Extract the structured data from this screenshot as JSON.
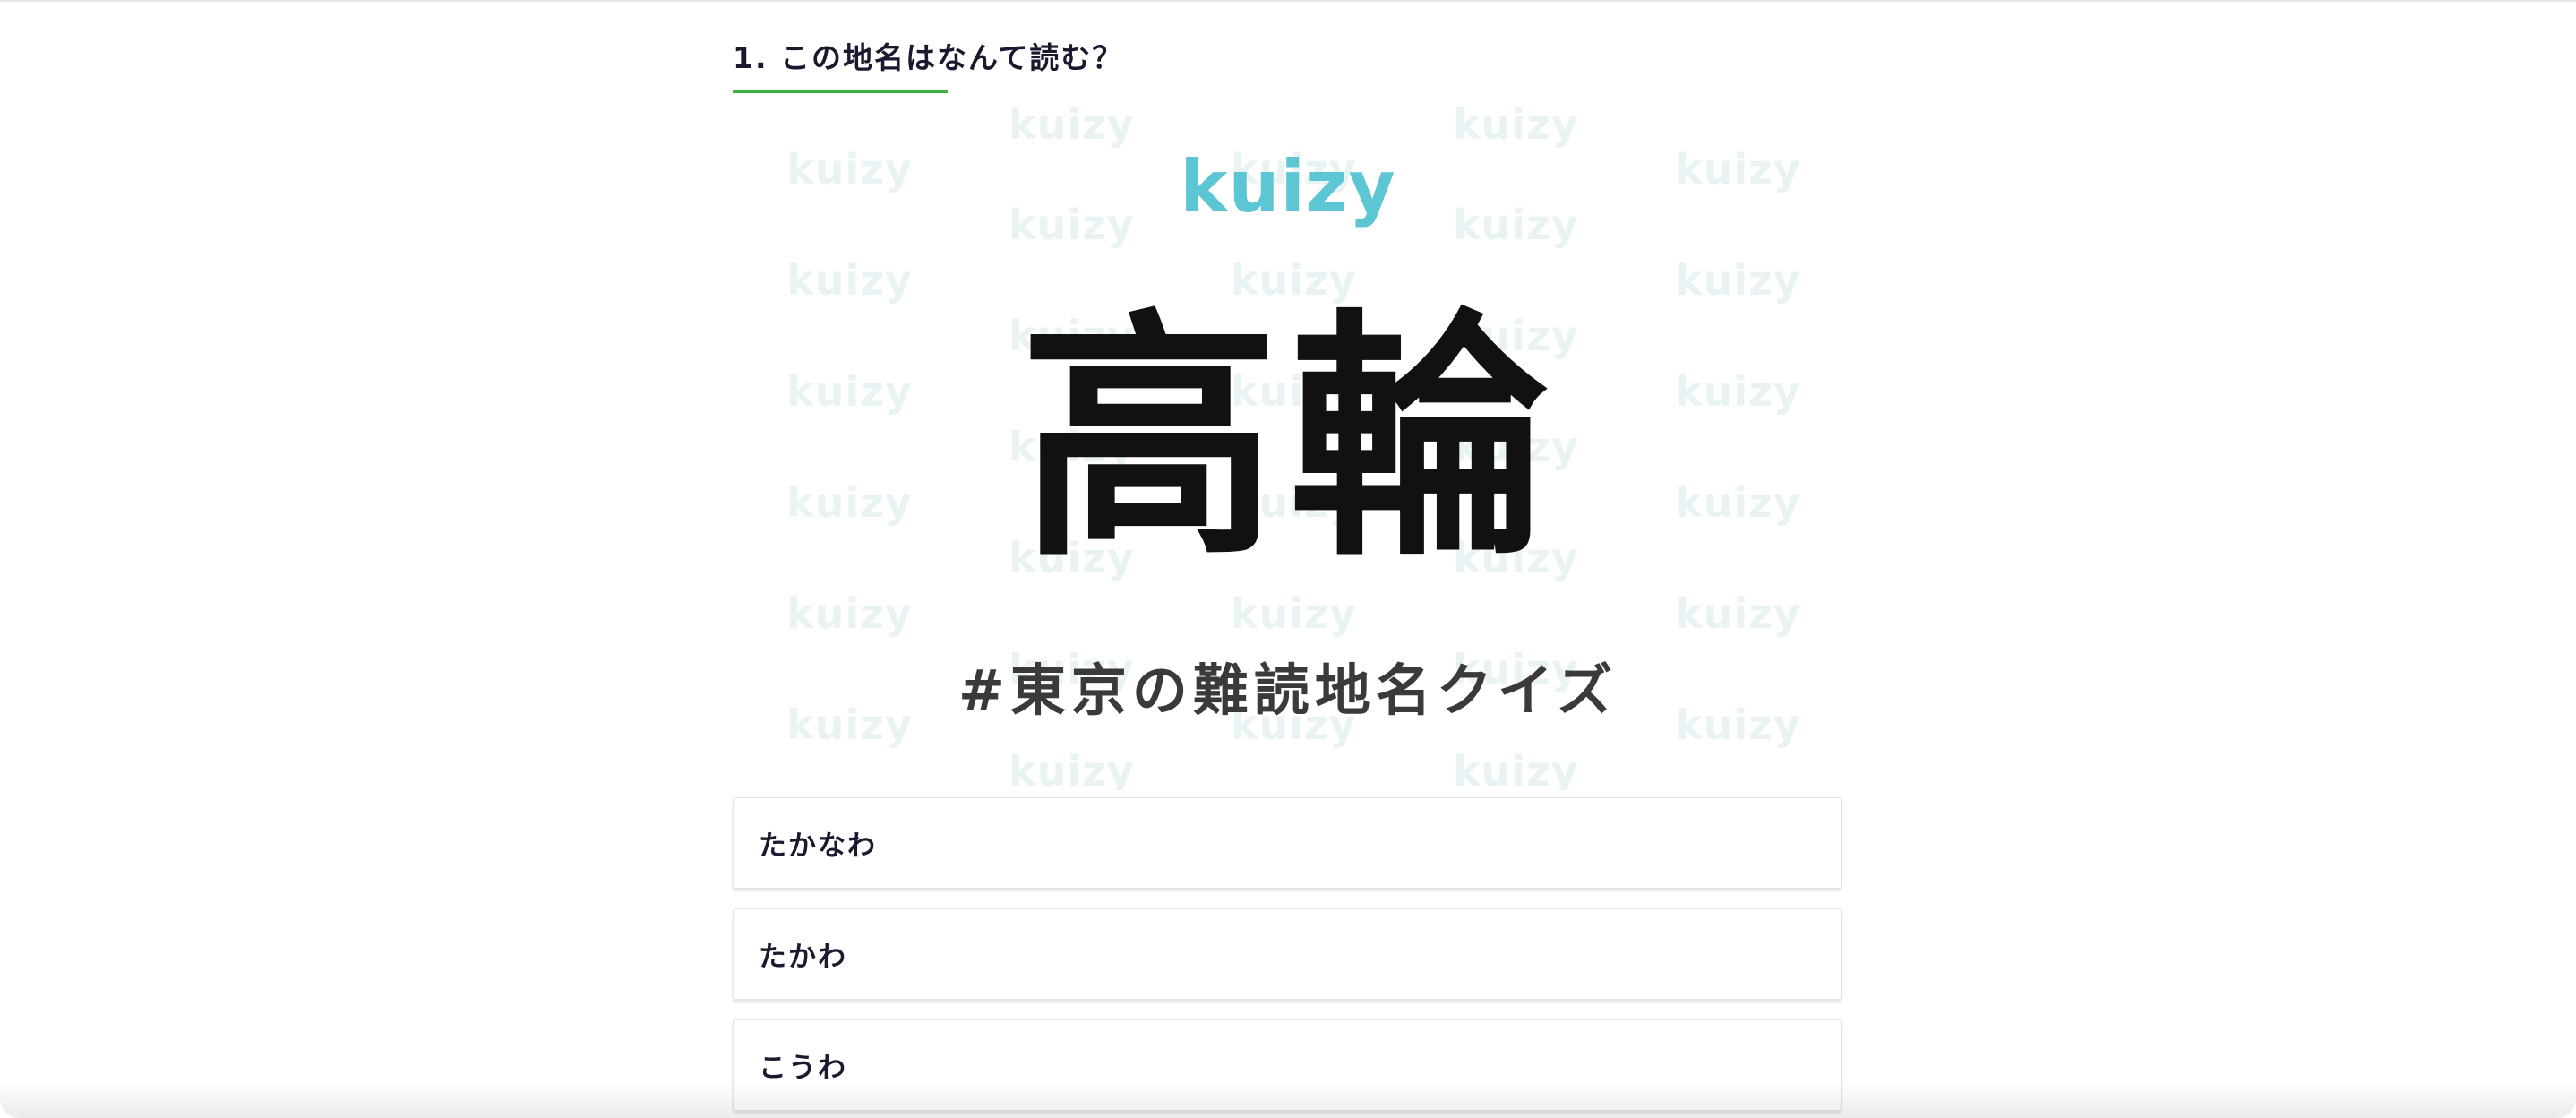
{
  "question": {
    "title": "1. この地名はなんて読む？"
  },
  "quiz_image": {
    "brand": "kuizy",
    "kanji": "高輪",
    "hashtag": "#東京の難読地名クイズ",
    "watermark_text": "kuizy",
    "colors": {
      "brand": "#5cc6d4",
      "watermark": "#e9f3f3",
      "kanji": "#111111",
      "hashtag": "#3a3a3a"
    }
  },
  "options": [
    {
      "label": "たかなわ"
    },
    {
      "label": "たかわ"
    },
    {
      "label": "こうわ"
    }
  ],
  "colors": {
    "accent_underline": "#3cb043",
    "text": "#1a1a2e"
  }
}
